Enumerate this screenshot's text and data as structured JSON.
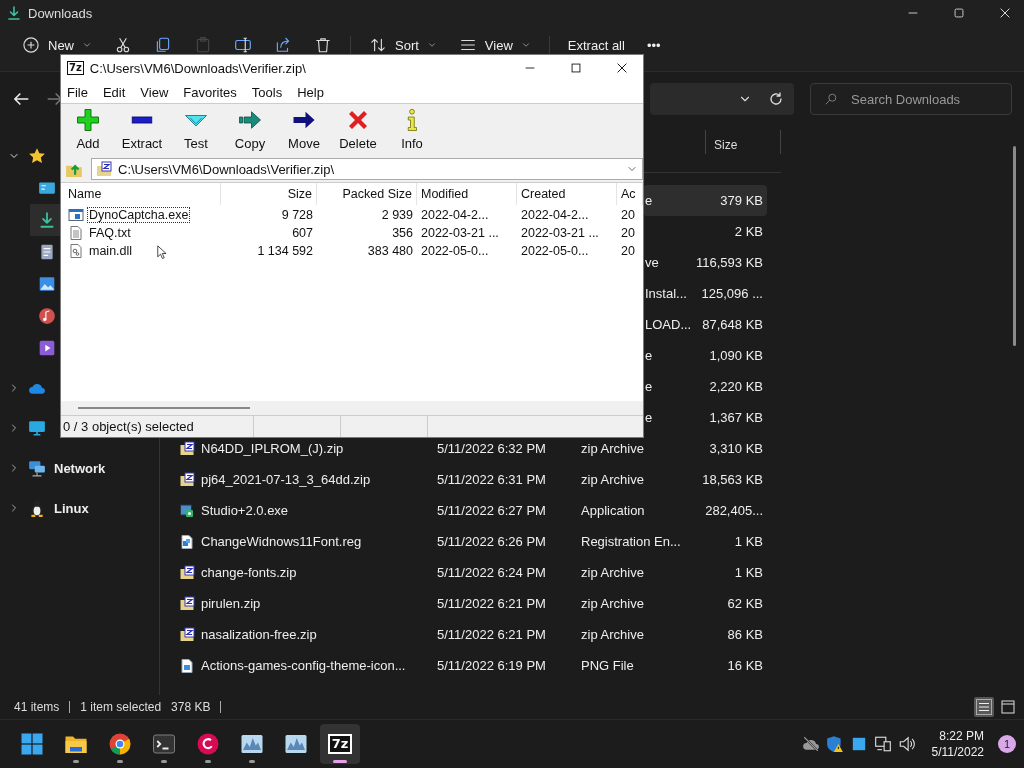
{
  "explorer": {
    "title": "Downloads",
    "commands": [
      {
        "kind": "new",
        "label": "New",
        "disabled": false
      },
      {
        "kind": "cut",
        "disabled": false
      },
      {
        "kind": "copy",
        "disabled": false
      },
      {
        "kind": "paste",
        "disabled": true
      },
      {
        "kind": "rename",
        "disabled": false
      },
      {
        "kind": "share",
        "disabled": false
      },
      {
        "kind": "delete",
        "disabled": false
      },
      {
        "kind": "sort",
        "label": "Sort",
        "disabled": false
      },
      {
        "kind": "view",
        "label": "View",
        "disabled": false
      },
      {
        "kind": "extract",
        "label": "Extract all",
        "disabled": false
      },
      {
        "kind": "more",
        "label": "•••",
        "disabled": false
      }
    ],
    "search": {
      "placeholder": "Search Downloads"
    },
    "sidebar": {
      "items": [
        {
          "kind": "star",
          "expanded": true,
          "selected": false,
          "children": [
            {
              "kind": "desktop",
              "selected": false
            },
            {
              "kind": "downloads",
              "selected": true
            },
            {
              "kind": "documents",
              "selected": false
            },
            {
              "kind": "pictures",
              "selected": false
            },
            {
              "kind": "music",
              "selected": false
            },
            {
              "kind": "videos",
              "selected": false
            }
          ]
        },
        {
          "kind": "cloud",
          "expanded": false,
          "selected": false
        },
        {
          "kind": "pc",
          "expanded": false,
          "selected": false
        },
        {
          "kind": "network",
          "label": "Network",
          "expanded": false,
          "selected": false
        },
        {
          "kind": "linux",
          "label": "Linux",
          "expanded": false,
          "selected": false
        }
      ]
    },
    "list": {
      "columns": [
        {
          "label": "Size"
        }
      ],
      "rows": [
        {
          "kind": "covered",
          "type": "e",
          "size": "379 KB",
          "selected": true
        },
        {
          "kind": "covered",
          "size": "2 KB",
          "selected": false
        },
        {
          "kind": "covered",
          "type": "ve",
          "size": "116,593 KB",
          "selected": false
        },
        {
          "kind": "covered",
          "type": "Instal...",
          "size": "125,096 ...",
          "selected": false
        },
        {
          "kind": "covered",
          "type": "LOAD...",
          "size": "87,648 KB",
          "selected": false
        },
        {
          "kind": "covered",
          "type": "e",
          "size": "1,090 KB",
          "selected": false
        },
        {
          "kind": "covered",
          "type": "e",
          "size": "2,220 KB",
          "selected": false
        },
        {
          "kind": "covered",
          "type": "e",
          "size": "1,367 KB",
          "selected": false
        },
        {
          "kind": "zip",
          "name": "N64DD_IPLROM_(J).zip",
          "date": "5/11/2022 6:32 PM",
          "type": "zip Archive",
          "size": "3,310 KB",
          "selected": false
        },
        {
          "kind": "zip",
          "name": "pj64_2021-07-13_3_64dd.zip",
          "date": "5/11/2022 6:31 PM",
          "type": "zip Archive",
          "size": "18,563 KB",
          "selected": false
        },
        {
          "kind": "exe",
          "name": "Studio+2.0.exe",
          "date": "5/11/2022 6:27 PM",
          "type": "Application",
          "size": "282,405...",
          "selected": false
        },
        {
          "kind": "reg",
          "name": "ChangeWidnows11Font.reg",
          "date": "5/11/2022 6:26 PM",
          "type": "Registration En...",
          "size": "1 KB",
          "selected": false
        },
        {
          "kind": "zip",
          "name": "change-fonts.zip",
          "date": "5/11/2022 6:24 PM",
          "type": "zip Archive",
          "size": "1 KB",
          "selected": false
        },
        {
          "kind": "zip",
          "name": "pirulen.zip",
          "date": "5/11/2022 6:21 PM",
          "type": "zip Archive",
          "size": "62 KB",
          "selected": false
        },
        {
          "kind": "zip",
          "name": "nasalization-free.zip",
          "date": "5/11/2022 6:21 PM",
          "type": "zip Archive",
          "size": "86 KB",
          "selected": false
        },
        {
          "kind": "png",
          "name": "Actions-games-config-theme-icon...",
          "date": "5/11/2022 6:19 PM",
          "type": "PNG File",
          "size": "16 KB",
          "selected": false
        }
      ]
    },
    "status_bar": {
      "count": "41 items",
      "selection": "1 item selected",
      "selection_size": "378 KB",
      "views": [
        {
          "kind": "details",
          "selected": true
        },
        {
          "kind": "tiles",
          "selected": false
        }
      ]
    }
  },
  "archiver": {
    "logo": "7z",
    "title": "C:\\Users\\VM6\\Downloads\\Verifier.zip\\",
    "menu": [
      "File",
      "Edit",
      "View",
      "Favorites",
      "Tools",
      "Help"
    ],
    "tools": [
      {
        "kind": "add",
        "label": "Add"
      },
      {
        "kind": "extract",
        "label": "Extract"
      },
      {
        "kind": "test",
        "label": "Test"
      },
      {
        "kind": "copy",
        "label": "Copy"
      },
      {
        "kind": "move",
        "label": "Move"
      },
      {
        "kind": "delete",
        "label": "Delete"
      },
      {
        "kind": "info",
        "label": "Info"
      }
    ],
    "path": "C:\\Users\\VM6\\Downloads\\Verifier.zip\\",
    "columns": [
      "Name",
      "Size",
      "Packed Size",
      "Modified",
      "Created",
      "Ac"
    ],
    "rows": [
      {
        "kind": "exe",
        "name": "DynoCaptcha.exe",
        "size": "9 728",
        "packed": "2 939",
        "modified": "2022-04-2...",
        "created": "2022-04-2...",
        "column_6": "20",
        "focused": true
      },
      {
        "kind": "txt",
        "name": "FAQ.txt",
        "size": "607",
        "packed": "356",
        "modified": "2022-03-21 ...",
        "created": "2022-03-21 ...",
        "column_6": "20",
        "focused": false
      },
      {
        "kind": "dll",
        "name": "main.dll",
        "size": "1 134 592",
        "packed": "383 480",
        "modified": "2022-05-0...",
        "created": "2022-05-0...",
        "column_6": "20",
        "focused": false
      }
    ],
    "status": "0 / 3 object(s) selected"
  },
  "taskbar": {
    "apps": [
      {
        "kind": "start",
        "running": false,
        "active": false
      },
      {
        "kind": "folder",
        "running": true,
        "active": false
      },
      {
        "kind": "chrome",
        "running": true,
        "active": false
      },
      {
        "kind": "terminal",
        "running": true,
        "active": false
      },
      {
        "kind": "debian",
        "running": true,
        "active": false
      },
      {
        "kind": "monitor",
        "running": true,
        "active": false
      },
      {
        "kind": "monitor",
        "running": false,
        "active": false
      },
      {
        "kind": "sevenzip",
        "label": "7z",
        "running": true,
        "active": true
      }
    ],
    "tray": [
      {
        "kind": "cloudoff"
      },
      {
        "kind": "shield"
      },
      {
        "kind": "square"
      },
      {
        "kind": "network"
      },
      {
        "kind": "speaker"
      }
    ],
    "time": "8:22 PM",
    "date": "5/11/2022",
    "badge": "1"
  }
}
